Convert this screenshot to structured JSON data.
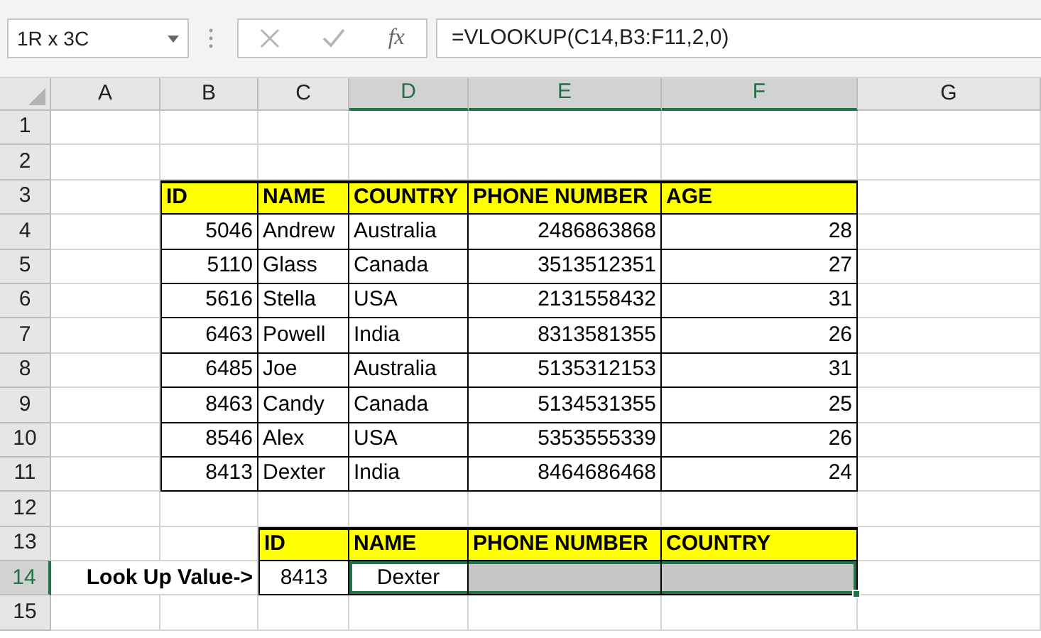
{
  "name_box": {
    "value": "1R x 3C"
  },
  "formula_bar": {
    "cancel_disabled": true,
    "enter_disabled": true,
    "function_label": "fx",
    "formula": "=VLOOKUP(C14,B3:F11,2,0)"
  },
  "columns": [
    {
      "label": "A",
      "selected": false
    },
    {
      "label": "B",
      "selected": false
    },
    {
      "label": "C",
      "selected": false
    },
    {
      "label": "D",
      "selected": true
    },
    {
      "label": "E",
      "selected": true
    },
    {
      "label": "F",
      "selected": true
    },
    {
      "label": "G",
      "selected": false
    }
  ],
  "rows": [
    {
      "number": "1",
      "selected": false,
      "cells": [
        {
          "kind": "blank",
          "selected": false
        },
        {
          "kind": "blank",
          "selected": false
        },
        {
          "kind": "blank",
          "selected": false
        },
        {
          "kind": "blank",
          "selected": false
        },
        {
          "kind": "blank",
          "selected": false
        },
        {
          "kind": "blank",
          "selected": false
        },
        {
          "kind": "blank",
          "selected": false
        }
      ]
    },
    {
      "number": "2",
      "selected": false,
      "cells": [
        {
          "kind": "blank",
          "selected": false
        },
        {
          "kind": "blank",
          "selected": false
        },
        {
          "kind": "blank",
          "selected": false
        },
        {
          "kind": "blank",
          "selected": false
        },
        {
          "kind": "blank",
          "selected": false
        },
        {
          "kind": "blank",
          "selected": false
        },
        {
          "kind": "blank",
          "selected": false
        }
      ]
    },
    {
      "number": "3",
      "selected": false,
      "cells": [
        {
          "kind": "blank",
          "selected": false
        },
        {
          "kind": "header",
          "text": "ID",
          "selected": false
        },
        {
          "kind": "header",
          "text": "NAME",
          "selected": false
        },
        {
          "kind": "header",
          "text": "COUNTRY",
          "selected": false
        },
        {
          "kind": "header",
          "text": "PHONE NUMBER",
          "selected": false
        },
        {
          "kind": "header",
          "text": "AGE",
          "selected": false
        },
        {
          "kind": "blank",
          "selected": false
        }
      ]
    },
    {
      "number": "4",
      "selected": false,
      "cells": [
        {
          "kind": "blank",
          "selected": false
        },
        {
          "kind": "number",
          "text": "5046",
          "selected": false
        },
        {
          "kind": "text",
          "text": "Andrew",
          "selected": false
        },
        {
          "kind": "text",
          "text": "Australia",
          "selected": false
        },
        {
          "kind": "number",
          "text": "2486863868",
          "selected": false
        },
        {
          "kind": "number",
          "text": "28",
          "selected": false
        },
        {
          "kind": "blank",
          "selected": false
        }
      ]
    },
    {
      "number": "5",
      "selected": false,
      "cells": [
        {
          "kind": "blank",
          "selected": false
        },
        {
          "kind": "number",
          "text": "5110",
          "selected": false
        },
        {
          "kind": "text",
          "text": "Glass",
          "selected": false
        },
        {
          "kind": "text",
          "text": "Canada",
          "selected": false
        },
        {
          "kind": "number",
          "text": "3513512351",
          "selected": false
        },
        {
          "kind": "number",
          "text": "27",
          "selected": false
        },
        {
          "kind": "blank",
          "selected": false
        }
      ]
    },
    {
      "number": "6",
      "selected": false,
      "cells": [
        {
          "kind": "blank",
          "selected": false
        },
        {
          "kind": "number",
          "text": "5616",
          "selected": false
        },
        {
          "kind": "text",
          "text": "Stella",
          "selected": false
        },
        {
          "kind": "text",
          "text": "USA",
          "selected": false
        },
        {
          "kind": "number",
          "text": "2131558432",
          "selected": false
        },
        {
          "kind": "number",
          "text": "31",
          "selected": false
        },
        {
          "kind": "blank",
          "selected": false
        }
      ]
    },
    {
      "number": "7",
      "selected": false,
      "cells": [
        {
          "kind": "blank",
          "selected": false
        },
        {
          "kind": "number",
          "text": "6463",
          "selected": false
        },
        {
          "kind": "text",
          "text": "Powell",
          "selected": false
        },
        {
          "kind": "text",
          "text": "India",
          "selected": false
        },
        {
          "kind": "number",
          "text": "8313581355",
          "selected": false
        },
        {
          "kind": "number",
          "text": "26",
          "selected": false
        },
        {
          "kind": "blank",
          "selected": false
        }
      ]
    },
    {
      "number": "8",
      "selected": false,
      "cells": [
        {
          "kind": "blank",
          "selected": false
        },
        {
          "kind": "number",
          "text": "6485",
          "selected": false
        },
        {
          "kind": "text",
          "text": "Joe",
          "selected": false
        },
        {
          "kind": "text",
          "text": "Australia",
          "selected": false
        },
        {
          "kind": "number",
          "text": "5135312153",
          "selected": false
        },
        {
          "kind": "number",
          "text": "31",
          "selected": false
        },
        {
          "kind": "blank",
          "selected": false
        }
      ]
    },
    {
      "number": "9",
      "selected": false,
      "cells": [
        {
          "kind": "blank",
          "selected": false
        },
        {
          "kind": "number",
          "text": "8463",
          "selected": false
        },
        {
          "kind": "text",
          "text": "Candy",
          "selected": false
        },
        {
          "kind": "text",
          "text": "Canada",
          "selected": false
        },
        {
          "kind": "number",
          "text": "5134531355",
          "selected": false
        },
        {
          "kind": "number",
          "text": "25",
          "selected": false
        },
        {
          "kind": "blank",
          "selected": false
        }
      ]
    },
    {
      "number": "10",
      "selected": false,
      "cells": [
        {
          "kind": "blank",
          "selected": false
        },
        {
          "kind": "number",
          "text": "8546",
          "selected": false
        },
        {
          "kind": "text",
          "text": "Alex",
          "selected": false
        },
        {
          "kind": "text",
          "text": "USA",
          "selected": false
        },
        {
          "kind": "number",
          "text": "5353555339",
          "selected": false
        },
        {
          "kind": "number",
          "text": "26",
          "selected": false
        },
        {
          "kind": "blank",
          "selected": false
        }
      ]
    },
    {
      "number": "11",
      "selected": false,
      "cells": [
        {
          "kind": "blank",
          "selected": false
        },
        {
          "kind": "number",
          "text": "8413",
          "selected": false
        },
        {
          "kind": "text",
          "text": "Dexter",
          "selected": false
        },
        {
          "kind": "text",
          "text": "India",
          "selected": false
        },
        {
          "kind": "number",
          "text": "8464686468",
          "selected": false
        },
        {
          "kind": "number",
          "text": "24",
          "selected": false
        },
        {
          "kind": "blank",
          "selected": false
        }
      ]
    },
    {
      "number": "12",
      "selected": false,
      "cells": [
        {
          "kind": "blank",
          "selected": false
        },
        {
          "kind": "blank",
          "selected": false
        },
        {
          "kind": "blank",
          "selected": false
        },
        {
          "kind": "blank",
          "selected": false
        },
        {
          "kind": "blank",
          "selected": false
        },
        {
          "kind": "blank",
          "selected": false
        },
        {
          "kind": "blank",
          "selected": false
        }
      ]
    },
    {
      "number": "13",
      "selected": false,
      "cells": [
        {
          "kind": "blank",
          "selected": false
        },
        {
          "kind": "blank",
          "selected": false
        },
        {
          "kind": "header",
          "text": "ID",
          "selected": false
        },
        {
          "kind": "header",
          "text": "NAME",
          "selected": false
        },
        {
          "kind": "header",
          "text": "PHONE NUMBER",
          "selected": false
        },
        {
          "kind": "header",
          "text": "COUNTRY",
          "selected": false
        },
        {
          "kind": "blank",
          "selected": false
        }
      ]
    },
    {
      "number": "14",
      "selected": true,
      "cells": [
        {
          "kind": "label",
          "text": "Look Up Value->",
          "selected": false
        },
        {
          "kind": "center",
          "text": "8413",
          "selected": false
        },
        {
          "kind": "center",
          "text": "Dexter",
          "selected": true
        },
        {
          "kind": "shaded",
          "selected": true
        },
        {
          "kind": "shaded",
          "selected": true
        },
        {
          "kind": "blank",
          "selected": false
        }
      ]
    },
    {
      "number": "15",
      "selected": false,
      "cells": [
        {
          "kind": "blank",
          "selected": false
        },
        {
          "kind": "blank",
          "selected": false
        },
        {
          "kind": "blank",
          "selected": false
        },
        {
          "kind": "blank",
          "selected": false
        },
        {
          "kind": "blank",
          "selected": false
        },
        {
          "kind": "blank",
          "selected": false
        },
        {
          "kind": "blank",
          "selected": false
        }
      ]
    }
  ]
}
